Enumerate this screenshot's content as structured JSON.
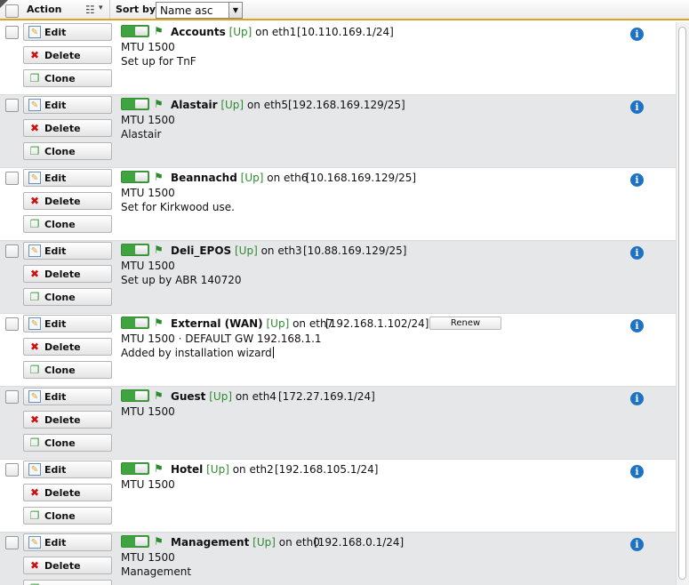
{
  "header": {
    "action_label": "Action",
    "list_icon": "list-icon",
    "dropdown_icon": "▾",
    "sortby_label": "Sort by:",
    "sort_value": "Name asc"
  },
  "buttons": {
    "edit": "Edit",
    "delete": "Delete",
    "clone": "Clone",
    "renew": "Renew"
  },
  "colors": {
    "accent": "#e0a020",
    "up": "#2e8a2e",
    "info": "#1d72c4"
  },
  "interfaces": [
    {
      "name": "Accounts",
      "status": "[Up]",
      "port": "on eth1",
      "ip": "[10.110.169.1/24]",
      "mtu": "MTU 1500",
      "description": "Set up for TnF"
    },
    {
      "name": "Alastair",
      "status": "[Up]",
      "port": "on eth5",
      "ip": "[192.168.169.129/25]",
      "mtu": "MTU 1500",
      "description": "Alastair"
    },
    {
      "name": "Beannachd",
      "status": "[Up]",
      "port": "on eth6",
      "ip": "[10.168.169.129/25]",
      "mtu": "MTU 1500",
      "description": "Set for Kirkwood use."
    },
    {
      "name": "Deli_EPOS",
      "status": "[Up]",
      "port": "on eth3",
      "ip": "[10.88.169.129/25]",
      "mtu": "MTU 1500",
      "description": "Set up by ABR 140720"
    },
    {
      "name": "External (WAN)",
      "status": "[Up]",
      "port": "on eth7",
      "ip": "[192.168.1.102/24]",
      "mtu": "MTU 1500 · DEFAULT GW 192.168.1.1",
      "description": "Added by installation wizard"
    },
    {
      "name": "Guest",
      "status": "[Up]",
      "port": "on eth4",
      "ip": "[172.27.169.1/24]",
      "mtu": "MTU 1500",
      "description": ""
    },
    {
      "name": "Hotel",
      "status": "[Up]",
      "port": "on eth2",
      "ip": "[192.168.105.1/24]",
      "mtu": "MTU 1500",
      "description": ""
    },
    {
      "name": "Management",
      "status": "[Up]",
      "port": "on eth0",
      "ip": "[192.168.0.1/24]",
      "mtu": "MTU 1500",
      "description": "Management"
    }
  ]
}
